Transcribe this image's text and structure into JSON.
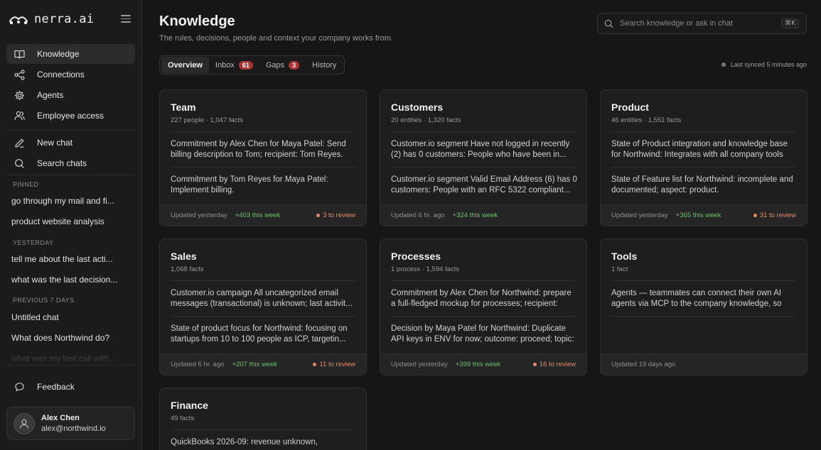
{
  "brand": {
    "name": "nerra.ai",
    "icon": "brand-logo-icon"
  },
  "sidebar": {
    "nav": [
      {
        "label": "Knowledge",
        "icon": "book-icon",
        "active": true
      },
      {
        "label": "Connections",
        "icon": "share-nodes-icon",
        "active": false
      },
      {
        "label": "Agents",
        "icon": "gear-icon",
        "active": false
      },
      {
        "label": "Employee access",
        "icon": "users-icon",
        "active": false
      }
    ],
    "actions": [
      {
        "label": "New chat",
        "icon": "pencil-icon"
      },
      {
        "label": "Search chats",
        "icon": "search-icon"
      }
    ],
    "pinned_heading": "PINNED",
    "pinned": [
      "go through my mail and fi...",
      "product website analysis"
    ],
    "yesterday_heading": "YESTERDAY",
    "yesterday": [
      "tell me about the last acti...",
      "what was the last decision..."
    ],
    "previous_heading": "PREVIOUS 7 DAYS",
    "previous": [
      "Untitled chat",
      "What does Northwind do?",
      "what was my last call with..."
    ],
    "feedback": {
      "label": "Feedback",
      "icon": "chat-bubble-icon"
    },
    "user": {
      "name": "Alex Chen",
      "email": "alex@northwind.io",
      "icon": "user-avatar-icon"
    }
  },
  "header": {
    "title": "Knowledge",
    "subtitle": "The rules, decisions, people and context your company works from.",
    "search_placeholder": "Search knowledge or ask in chat",
    "search_shortcut": "⌘K"
  },
  "tabs": [
    {
      "label": "Overview",
      "active": true,
      "badge": ""
    },
    {
      "label": "Inbox",
      "active": false,
      "badge": "61"
    },
    {
      "label": "Gaps",
      "active": false,
      "badge": "3"
    },
    {
      "label": "History",
      "active": false,
      "badge": ""
    }
  ],
  "sync_status": "Last synced 5 minutes ago",
  "cards": [
    {
      "title": "Team",
      "meta": "227 people · 1,047 facts",
      "facts": [
        "Commitment by Alex Chen for Maya Patel: Send billing description to Tom; recipient: Tom Reyes.",
        "Commitment by Tom Reyes for Maya Patel: Implement billing."
      ],
      "updated": "Updated yesterday",
      "week": "+403 this week",
      "review": "3 to review"
    },
    {
      "title": "Customers",
      "meta": "20 entities · 1,320 facts",
      "facts": [
        "Customer.io segment Have not logged in recently (2) has 0 customers: People who have been in...",
        "Customer.io segment Valid Email Address (6) has 0 customers: People with an RFC 5322 compliant..."
      ],
      "updated": "Updated 6 hr. ago",
      "week": "+324 this week",
      "review": ""
    },
    {
      "title": "Product",
      "meta": "46 entities · 1,551 facts",
      "facts": [
        "State of Product integration and knowledge base for Northwind: Integrates with all company tools",
        "State of Feature list for Northwind: incomplete and documented; aspect: product."
      ],
      "updated": "Updated yesterday",
      "week": "+365 this week",
      "review": "31 to review"
    },
    {
      "title": "Sales",
      "meta": "1,068 facts",
      "facts": [
        "Customer.io campaign All uncategorized email messages (transactional) is unknown; last activit...",
        "State of product focus for Northwind: focusing on startups from 10 to 100 people as ICP, targetin..."
      ],
      "updated": "Updated 6 hr. ago",
      "week": "+207 this week",
      "review": "11 to review"
    },
    {
      "title": "Processes",
      "meta": "1 process · 1,594 facts",
      "facts": [
        "Commitment by Alex Chen for Northwind: prepare a full-fledged mockup for processes; recipient:",
        "Decision by Maya Patel for Northwind: Duplicate API keys in ENV for now; outcome: proceed; topic:"
      ],
      "updated": "Updated yesterday",
      "week": "+399 this week",
      "review": "16 to review"
    },
    {
      "title": "Tools",
      "meta": "1 fact",
      "facts": [
        "Agents — teammates can connect their own AI agents via MCP to the company knowledge, so"
      ],
      "updated": "Updated 19 days ago",
      "week": "",
      "review": ""
    },
    {
      "title": "Finance",
      "meta": "49 facts",
      "facts": [
        "QuickBooks 2026-09: revenue unknown,"
      ],
      "updated": "",
      "week": "",
      "review": ""
    }
  ],
  "colors": {
    "accent_green": "#6fbf73",
    "review_orange": "#e38a6d",
    "badge_red": "#a83434"
  }
}
